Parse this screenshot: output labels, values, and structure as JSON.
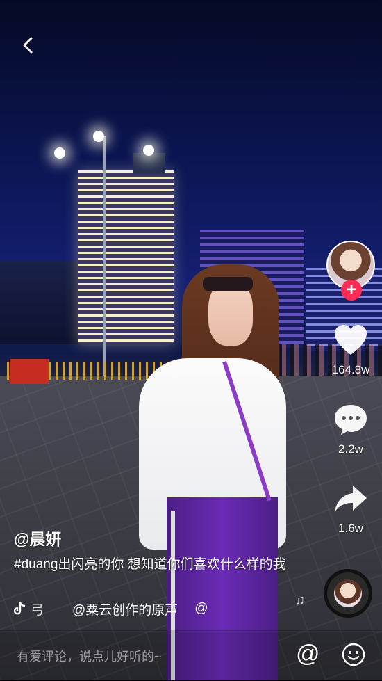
{
  "nav": {
    "back_icon": "chevron-left-icon"
  },
  "author": {
    "avatar_icon": "avatar",
    "follow_label": "+"
  },
  "actions": {
    "like": {
      "icon": "heart-icon",
      "count": "164.8w"
    },
    "comment": {
      "icon": "comment-bubble-icon",
      "count": "2.2w"
    },
    "share": {
      "icon": "share-arrow-icon",
      "count": "1.6w"
    }
  },
  "video": {
    "username": "@晨妍",
    "caption": "#duang出闪亮的你 想知道你们喜欢什么样的我",
    "music_prefix": "弓",
    "music_title": "@粟云创作的原声",
    "music_suffix": "@"
  },
  "comment_bar": {
    "placeholder": "有爱评论，说点儿好听的~",
    "mention_label": "@",
    "emoji_icon": "smiley-icon"
  },
  "colors": {
    "accent": "#fe2c55"
  }
}
